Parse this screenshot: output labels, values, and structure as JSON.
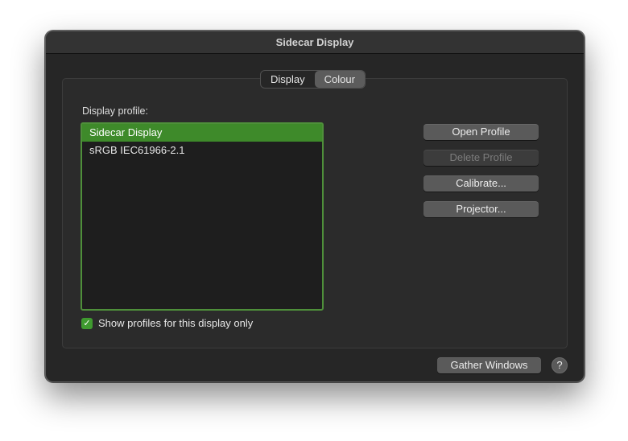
{
  "window": {
    "title": "Sidecar Display"
  },
  "tabs": [
    {
      "label": "Display",
      "active": false
    },
    {
      "label": "Colour",
      "active": true
    }
  ],
  "colour": {
    "profile_label": "Display profile:",
    "profiles": [
      {
        "name": "Sidecar Display",
        "selected": true
      },
      {
        "name": "sRGB IEC61966-2.1",
        "selected": false
      }
    ],
    "show_only_label": "Show profiles for this display only",
    "show_only_checked": true,
    "buttons": {
      "open": "Open Profile",
      "delete": "Delete Profile",
      "calibrate": "Calibrate...",
      "projector": "Projector..."
    }
  },
  "footer": {
    "gather_windows": "Gather Windows",
    "help_glyph": "?"
  },
  "icons": {
    "checkmark": "checkmark-icon",
    "help": "question-mark-icon"
  },
  "colors": {
    "accent": "#3e8a2a",
    "window_bg": "#262626"
  }
}
